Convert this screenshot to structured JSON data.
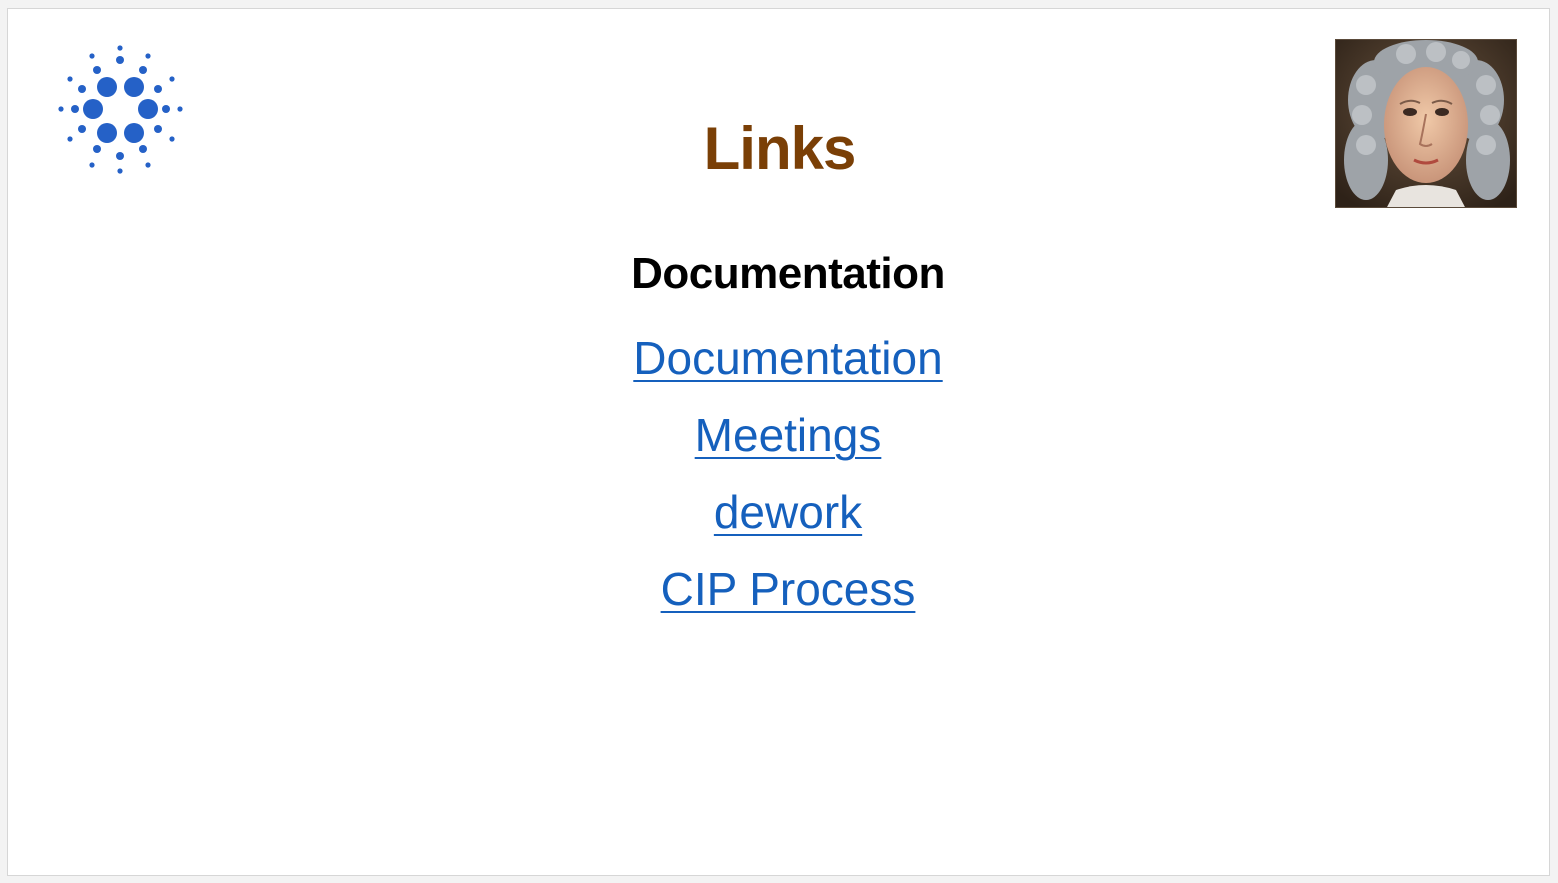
{
  "slide": {
    "title": "Links",
    "subtitle": "Documentation",
    "links": [
      "Documentation",
      "Meetings",
      "dework",
      "CIP Process"
    ]
  },
  "colors": {
    "title": "#7a3f06",
    "link": "#1560bd",
    "logo": "#2561c7",
    "text": "#000000"
  },
  "icons": {
    "logo": "cardano-logo-icon",
    "portrait": "portrait-image"
  }
}
